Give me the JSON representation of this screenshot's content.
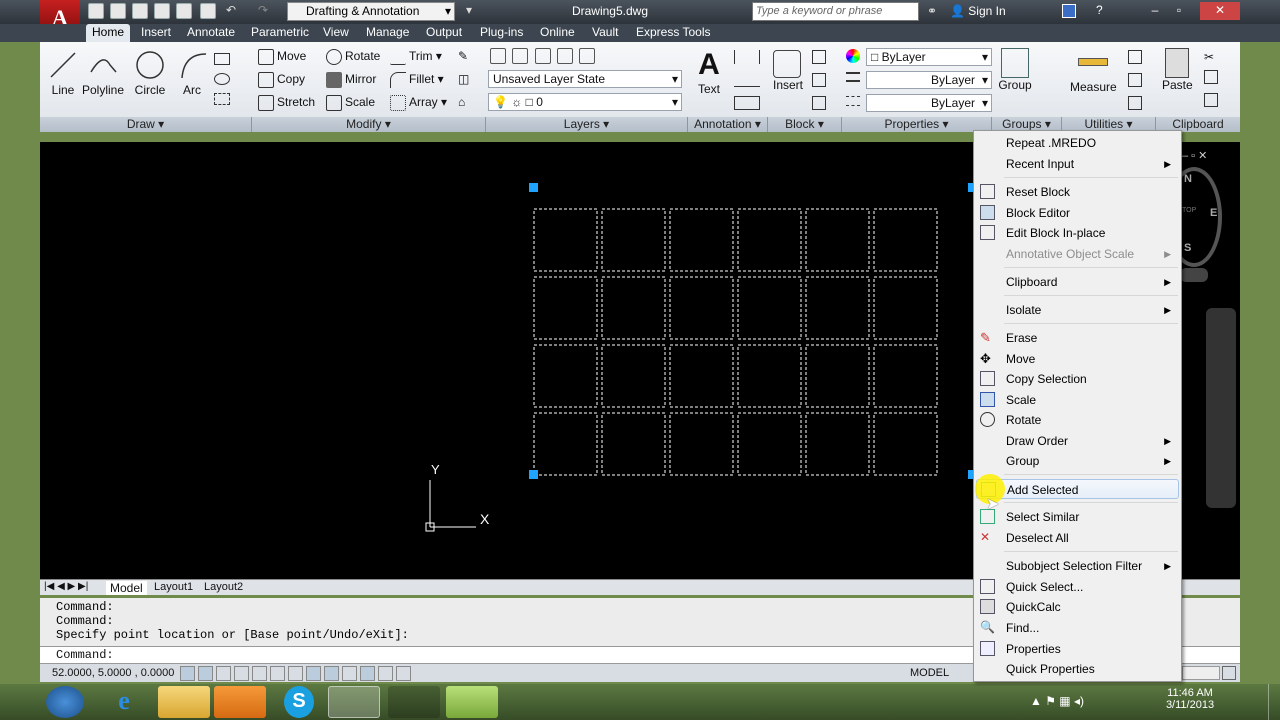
{
  "titlebar": {
    "app_letter": "A",
    "workspace": "Drafting & Annotation",
    "document": "Drawing5.dwg",
    "search_placeholder": "Type a keyword or phrase",
    "signin": "Sign In"
  },
  "tabs": [
    "Home",
    "Insert",
    "Annotate",
    "Parametric",
    "View",
    "Manage",
    "Output",
    "Plug-ins",
    "Online",
    "Vault",
    "Express Tools"
  ],
  "ribbon": {
    "draw": {
      "title": "Draw",
      "line": "Line",
      "polyline": "Polyline",
      "circle": "Circle",
      "arc": "Arc"
    },
    "modify": {
      "title": "Modify",
      "move": "Move",
      "rotate": "Rotate",
      "trim": "Trim",
      "copy": "Copy",
      "mirror": "Mirror",
      "fillet": "Fillet",
      "stretch": "Stretch",
      "scale": "Scale",
      "array": "Array"
    },
    "layers": {
      "title": "Layers",
      "state": "Unsaved Layer State",
      "current": "0"
    },
    "annotation": {
      "title": "Annotation",
      "text": "Text"
    },
    "block": {
      "title": "Block",
      "insert": "Insert"
    },
    "properties": {
      "title": "Properties",
      "color": "ByLayer",
      "linetype": "ByLayer",
      "lineweight": "ByLayer"
    },
    "groups": {
      "title": "Groups",
      "group": "Group"
    },
    "utilities": {
      "title": "Utilities",
      "measure": "Measure"
    },
    "clipboard": {
      "title": "Clipboard",
      "paste": "Paste"
    }
  },
  "layout_tabs": [
    "Model",
    "Layout1",
    "Layout2"
  ],
  "command": {
    "history": [
      "Command:",
      "Command:",
      "Specify point location or [Base point/Undo/eXit]:"
    ],
    "prompt": "Command:"
  },
  "status": {
    "coords": "52.0000, 5.0000 , 0.0000",
    "space": "MODEL"
  },
  "ucs": {
    "x": "X",
    "y": "Y"
  },
  "viewcube": {
    "n": "N",
    "e": "E",
    "s": "S",
    "top": "TOP"
  },
  "context_menu": {
    "repeat": "Repeat .MREDO",
    "recent_input": "Recent Input",
    "reset_block": "Reset Block",
    "block_editor": "Block Editor",
    "edit_block_inplace": "Edit Block In-place",
    "annotative_scale": "Annotative Object Scale",
    "clipboard": "Clipboard",
    "isolate": "Isolate",
    "erase": "Erase",
    "move": "Move",
    "copy_selection": "Copy Selection",
    "scale": "Scale",
    "rotate": "Rotate",
    "draw_order": "Draw Order",
    "group": "Group",
    "add_selected": "Add Selected",
    "select_similar": "Select Similar",
    "deselect_all": "Deselect All",
    "subobject_filter": "Subobject Selection Filter",
    "quick_select": "Quick Select...",
    "quickcalc": "QuickCalc",
    "find": "Find...",
    "properties": "Properties",
    "quick_properties": "Quick Properties"
  },
  "taskbar": {
    "time": "11:46 AM",
    "date": "3/11/2013"
  }
}
